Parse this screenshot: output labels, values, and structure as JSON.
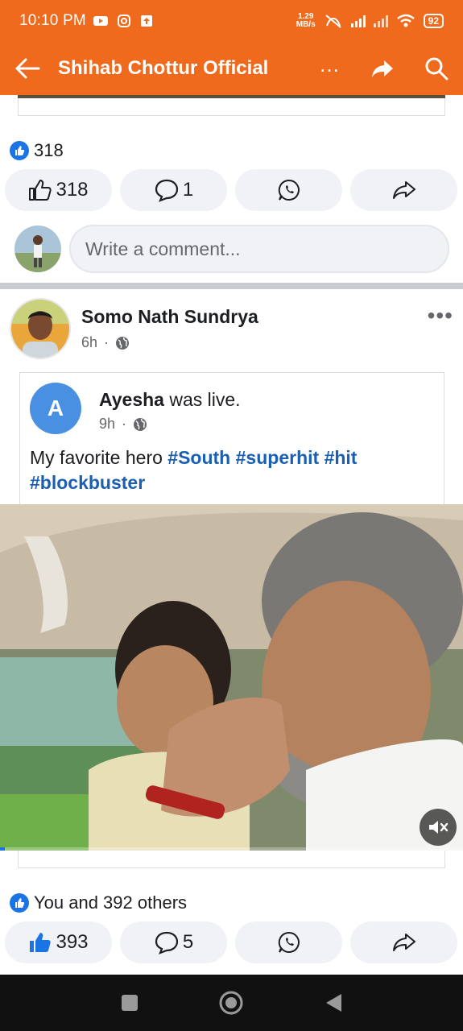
{
  "status_bar": {
    "time": "10:10 PM",
    "net_speed_value": "1.29",
    "net_speed_unit": "MB/s",
    "battery": "92"
  },
  "toolbar": {
    "title": "Shihab Chottur Official",
    "more_icon": "more-dots-icon",
    "share_icon": "share-arrow-icon",
    "search_icon": "search-icon",
    "back_icon": "back-arrow-icon"
  },
  "post1": {
    "reaction_summary": "318",
    "like_count": "318",
    "comment_count": "1",
    "comment_placeholder": "Write a comment..."
  },
  "post2": {
    "author": "Somo Nath Sundrya",
    "time": "6h",
    "shared": {
      "avatar_letter": "A",
      "author": "Ayesha",
      "action": "was live.",
      "time": "9h",
      "text": "My favorite hero ",
      "tags": [
        "#South",
        "#superhit",
        "#hit",
        "#blockbuster"
      ]
    },
    "video_progress": 0.01,
    "reaction_summary": "You and 392 others",
    "like_count": "393",
    "comment_count": "5"
  },
  "colors": {
    "brand": "#ef6a1c",
    "link": "#1a5fb4",
    "like_blue": "#1b74e4"
  }
}
